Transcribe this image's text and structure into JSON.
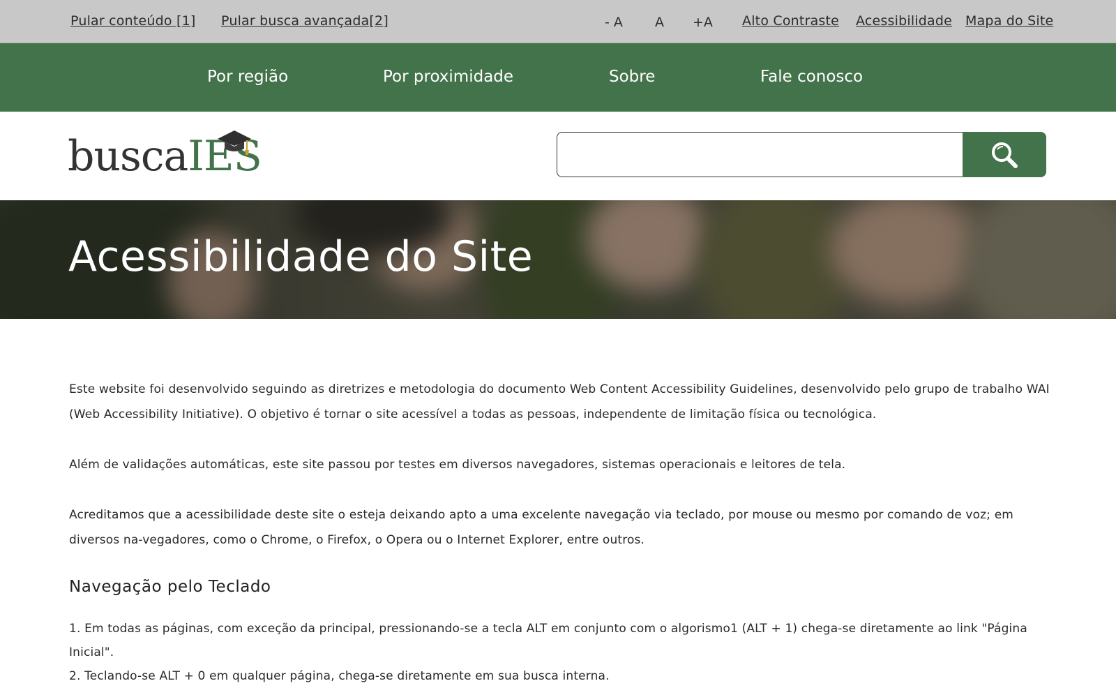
{
  "topbar": {
    "skip_content": "Pular conteúdo [1]",
    "skip_search": "Pular busca avançada[2]",
    "font_decrease": "- A",
    "font_default": "A",
    "font_increase": "+A",
    "high_contrast": "Alto Contraste",
    "accessibility": "Acessibilidade",
    "sitemap": "Mapa do Site"
  },
  "nav": {
    "items": [
      {
        "label": "Por região"
      },
      {
        "label": "Por proximidade"
      },
      {
        "label": "Sobre"
      },
      {
        "label": "Fale conosco"
      }
    ]
  },
  "header": {
    "logo_part1": "busca",
    "logo_part2": "IES",
    "search_placeholder": "",
    "search_icon": "search-icon"
  },
  "hero": {
    "title": "Acessibilidade do Site"
  },
  "content": {
    "paragraphs": [
      "Este website foi desenvolvido seguindo as diretrizes e metodologia do documento Web Content Accessibility Guidelines, desenvolvido pelo grupo de trabalho WAI (Web Accessibility Initiative). O objetivo é tornar o site acessível a todas as pessoas, independente de limitação física ou tecnológica.",
      "Além de validações automáticas, este site passou por testes em diversos navegadores, sistemas operacionais e leitores de tela.",
      "Acreditamos que a acessibilidade deste site o esteja deixando apto a uma excelente navegação via teclado, por mouse ou mesmo por comando de voz; em diversos na-vegadores, como o Chrome, o Firefox, o Opera ou o Internet Explorer, entre outros."
    ],
    "section_title": "Navegação pelo Teclado",
    "list": [
      "1. Em todas as páginas, com exceção da principal, pressionando-se a tecla ALT em conjunto com o algorismo1 (ALT + 1) chega-se diretamente ao link \"Página Inicial\".",
      "2. Teclando-se ALT + 0 em qualquer página, chega-se diretamente em sua busca interna."
    ]
  },
  "colors": {
    "brand_green": "#43734a",
    "topbar_gray": "#c8c8c8"
  }
}
